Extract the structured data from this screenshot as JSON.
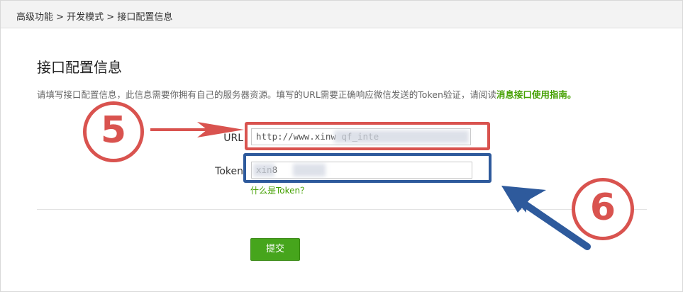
{
  "breadcrumb": "高级功能 > 开发模式 > 接口配置信息",
  "page": {
    "title": "接口配置信息",
    "description_prefix": "请填写接口配置信息，此信息需要你拥有自己的服务器资源。填写的URL需要正确响应微信发送的Token验证，请阅读",
    "description_link": "消息接口使用指南。"
  },
  "form": {
    "url_label": "URL",
    "url_value": "http://www.xinw          qf_inte",
    "token_label": "Token",
    "token_value": "  xin8",
    "token_help": "什么是Token？",
    "submit_label": "提交"
  },
  "annotations": {
    "marker_5": "5",
    "marker_6": "6",
    "red": "#d9534f",
    "blue": "#2e5a9c"
  }
}
